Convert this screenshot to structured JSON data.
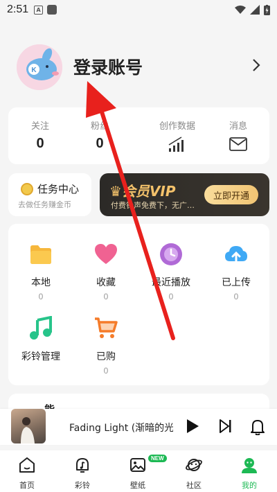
{
  "status_bar": {
    "time": "2:51",
    "notif_letter": "A"
  },
  "profile": {
    "login_label": "登录账号"
  },
  "stats": [
    {
      "label": "关注",
      "value": "0"
    },
    {
      "label": "粉丝",
      "value": "0"
    },
    {
      "label": "创作数据",
      "icon": "bar-chart-icon"
    },
    {
      "label": "消息",
      "icon": "mail-icon"
    }
  ],
  "task": {
    "title": "任务中心",
    "subtitle": "去做任务赚金币"
  },
  "vip": {
    "title": "会员VIP",
    "subtitle": "付费铃声免费下，无广…",
    "button": "立即开通"
  },
  "grid": [
    {
      "label": "本地",
      "count": "0",
      "icon": "folder-icon",
      "color": "#f6b73c"
    },
    {
      "label": "收藏",
      "count": "0",
      "icon": "heart-icon",
      "color": "#f06292"
    },
    {
      "label": "最近播放",
      "count": "0",
      "icon": "clock-icon",
      "color": "#b06ad6"
    },
    {
      "label": "已上传",
      "count": "0",
      "icon": "cloud-upload-icon",
      "color": "#3fa9f5"
    },
    {
      "label": "彩铃管理",
      "icon": "music-note-icon",
      "color": "#27c48a"
    },
    {
      "label": "已购",
      "count": "0",
      "icon": "cart-icon",
      "color": "#f57c2a"
    }
  ],
  "below_card": {
    "title_fragment": "能"
  },
  "player": {
    "song": "Fading Light (渐暗的光)-"
  },
  "tabs": [
    {
      "label": "首页",
      "icon": "home-icon"
    },
    {
      "label": "彩铃",
      "icon": "ringtone-icon"
    },
    {
      "label": "壁纸",
      "icon": "wallpaper-icon",
      "badge": "NEW"
    },
    {
      "label": "社区",
      "icon": "planet-icon"
    },
    {
      "label": "我的",
      "icon": "profile-icon",
      "active": true
    }
  ],
  "colors": {
    "accent": "#1db954",
    "arrow": "#e8211d",
    "vip_gold": "#f4c26b"
  }
}
